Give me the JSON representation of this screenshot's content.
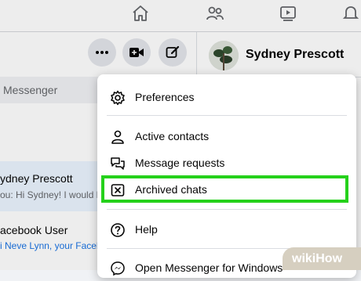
{
  "nav": {
    "icons": [
      "home-icon",
      "friends-icon",
      "watch-icon",
      "notifications-icon"
    ]
  },
  "conversation_list": {
    "search_text": "Messenger",
    "chats": [
      {
        "name": "ydney Prescott",
        "preview": "ou: Hi Sydney! I would li"
      },
      {
        "name": "acebook User",
        "preview": "i Neve Lynn, your Faceb"
      }
    ]
  },
  "contact": {
    "name": "Sydney Prescott"
  },
  "menu": {
    "items": [
      {
        "label": "Preferences",
        "icon": "gear-icon"
      },
      {
        "label": "Active contacts",
        "icon": "person-icon"
      },
      {
        "label": "Message requests",
        "icon": "chat-bubbles-icon"
      },
      {
        "label": "Archived chats",
        "icon": "archive-box-icon"
      },
      {
        "label": "Help",
        "icon": "help-icon"
      },
      {
        "label": "Open Messenger for Windows",
        "icon": "messenger-icon"
      }
    ]
  },
  "highlight_color": "#25d11b",
  "watermark": {
    "part1": "wiki",
    "part2": "How"
  }
}
